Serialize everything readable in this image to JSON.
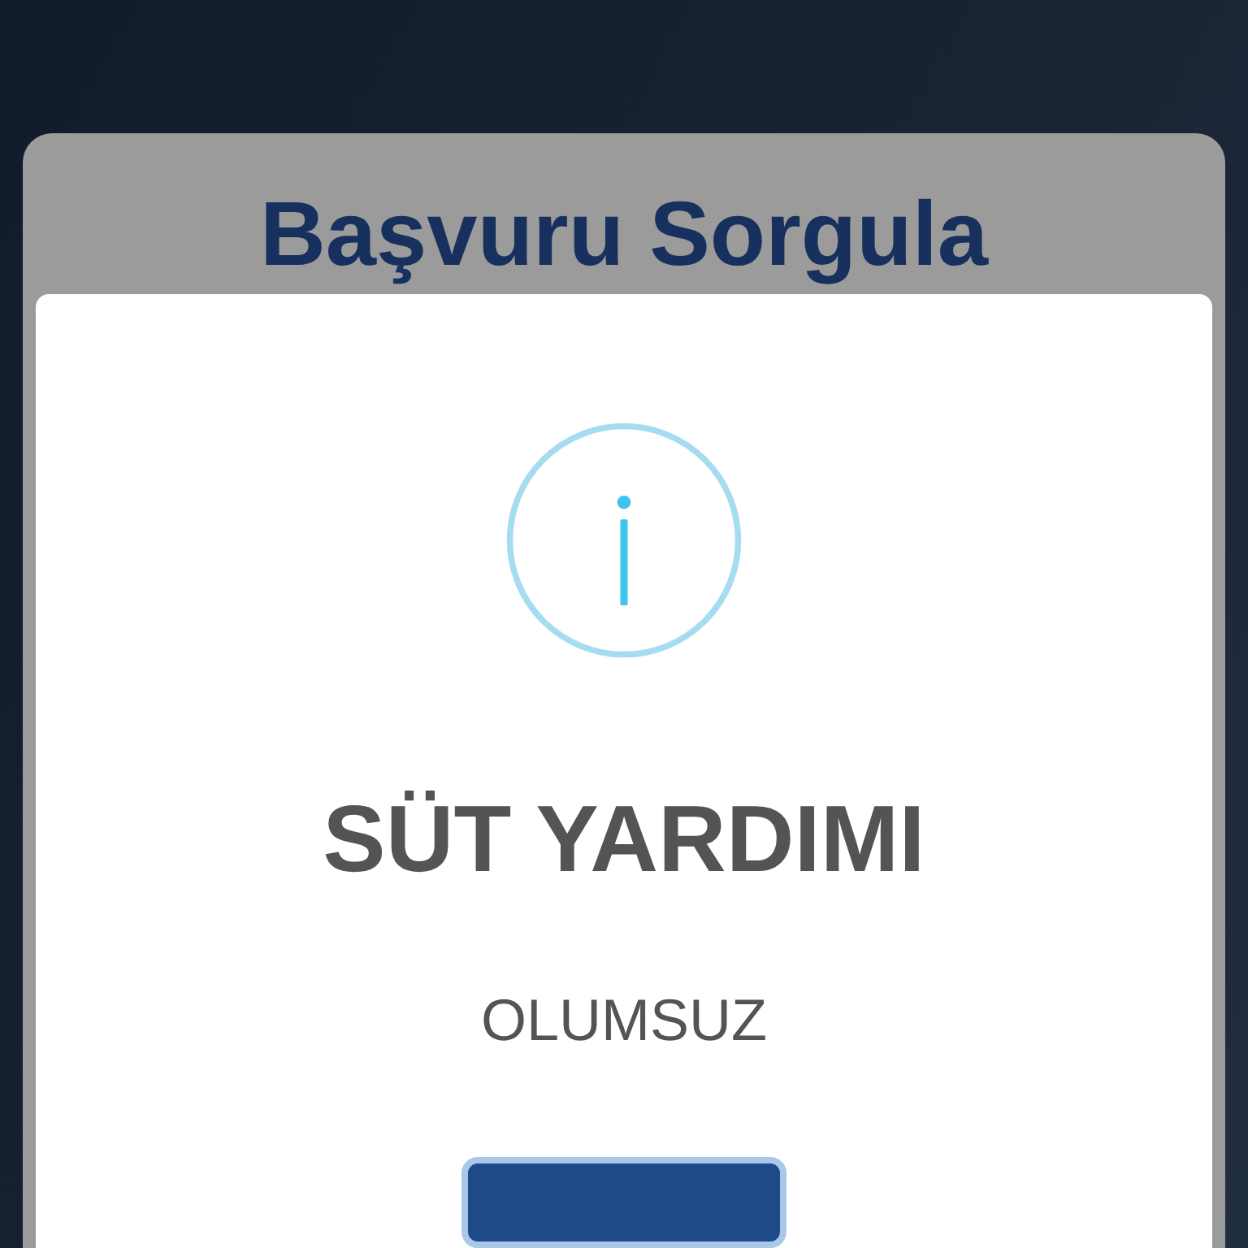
{
  "page_title": "Başvuru Sorgula",
  "dialog": {
    "title": "SÜT YARDIMI",
    "message": "OLUMSUZ",
    "button": {
      "focused": true
    }
  }
}
